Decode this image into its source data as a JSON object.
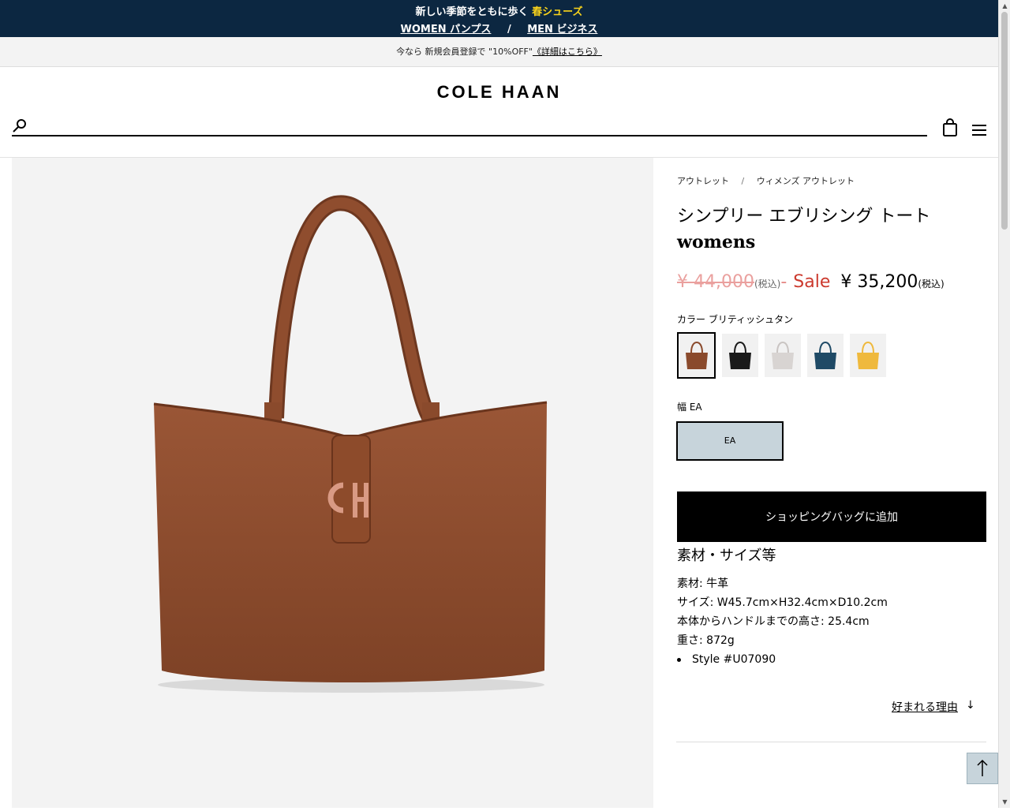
{
  "announcement": {
    "line1_prefix": "新しい季節をともに歩く",
    "line1_highlight": "春シューズ",
    "links": [
      "WOMEN パンプス",
      "MEN ビジネス"
    ],
    "separator": "/"
  },
  "promo": {
    "text": "今なら 新規会員登録で \"10%OFF\"",
    "link": "《詳細はこちら》"
  },
  "header": {
    "logo": "COLE HAAN",
    "search_placeholder": ""
  },
  "breadcrumb": [
    "アウトレット",
    "ウィメンズ アウトレット"
  ],
  "product": {
    "title": "シンプリー エブリシング トート",
    "subtitle": "womens",
    "price_old": "¥ 44,000",
    "price_old_tax": "(税込)",
    "price_dash": "-",
    "sale_label": "Sale",
    "price_now": "¥ 35,200",
    "price_now_tax": "(税込)",
    "color_label": "カラー ブリティッシュタン",
    "colors": [
      {
        "name": "british-tan",
        "hex": "#8a4a2c"
      },
      {
        "name": "black",
        "hex": "#1a1a1a"
      },
      {
        "name": "light-gray",
        "hex": "#d8d4d2"
      },
      {
        "name": "navy",
        "hex": "#1f4a66"
      },
      {
        "name": "yellow",
        "hex": "#efb93d"
      }
    ],
    "width_label": "幅 EA",
    "width_option": "EA",
    "add_to_bag": "ショッピングバッグに追加",
    "spec_title": "素材・サイズ等",
    "specs": [
      "素材: 牛革",
      "サイズ: W45.7cm×H32.4cm×D10.2cm",
      "本体からハンドルまでの高さ: 25.4cm",
      "重さ: 872g"
    ],
    "style": "Style #U07090",
    "why_link": "好まれる理由",
    "why_arrow": "↓"
  },
  "colors": {
    "topbar_bg": "#0c2741",
    "highlight": "#f7d21b",
    "sale": "#cc3a2e",
    "accent_light": "#c7d4db"
  }
}
